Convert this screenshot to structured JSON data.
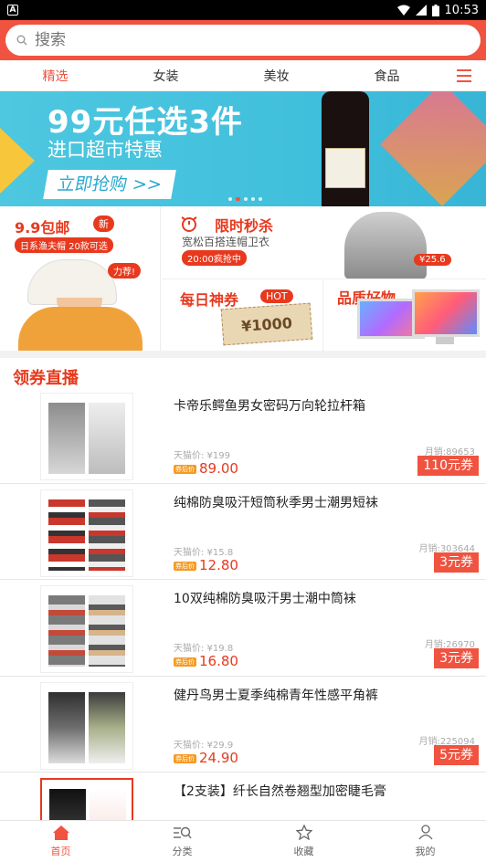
{
  "status_bar": {
    "time": "10:53",
    "app_icon": "A"
  },
  "search": {
    "placeholder": "搜索"
  },
  "categories": [
    {
      "label": "精选",
      "active": true
    },
    {
      "label": "女装"
    },
    {
      "label": "美妆"
    },
    {
      "label": "食品"
    }
  ],
  "banner": {
    "headline": "99元任选3件",
    "subtitle": "进口超市特惠",
    "cta": "立即抢购 >>",
    "dots_total": 5,
    "dot_active": 2
  },
  "promo": {
    "p1": {
      "title": "9.9包邮",
      "badge": "新",
      "strip": "日系渔夫帽 20款可选",
      "tag": "力荐!"
    },
    "p2": {
      "title": "限时秒杀",
      "subtitle": "宽松百搭连帽卫衣",
      "time_strip": "20:00疯抢中",
      "price_tag": "¥25.6"
    },
    "p3": {
      "title": "每日神券",
      "badge": "HOT",
      "coupon": "¥1000"
    },
    "p4": {
      "title": "品质好物"
    }
  },
  "section": {
    "title": "领券直播"
  },
  "products": [
    {
      "title": "卡帝乐鳄鱼男女密码万向轮拉杆箱",
      "orig": "天猫价: ¥199",
      "price": "89.00",
      "sales": "月销:89653",
      "coupon": "110元券",
      "price_tag": "券后价"
    },
    {
      "title": "纯棉防臭吸汗短筒秋季男士潮男短袜",
      "orig": "天猫价: ¥15.8",
      "price": "12.80",
      "sales": "月销:303644",
      "coupon": "3元券",
      "price_tag": "券后价"
    },
    {
      "title": "10双纯棉防臭吸汗男士潮中筒袜",
      "orig": "天猫价: ¥19.8",
      "price": "16.80",
      "sales": "月销:26970",
      "coupon": "3元券",
      "price_tag": "券后价"
    },
    {
      "title": "健丹鸟男士夏季纯棉青年性感平角裤",
      "orig": "天猫价: ¥29.9",
      "price": "24.90",
      "sales": "月销:225094",
      "coupon": "5元券",
      "price_tag": "券后价"
    },
    {
      "title": "【2支装】纤长自然卷翘型加密睫毛膏",
      "orig": "",
      "price": "",
      "sales": "",
      "coupon": "",
      "price_tag": ""
    }
  ],
  "tabbar": [
    {
      "label": "首页",
      "icon": "home-icon",
      "active": true
    },
    {
      "label": "分类",
      "icon": "category-search-icon"
    },
    {
      "label": "收藏",
      "icon": "star-icon"
    },
    {
      "label": "我的",
      "icon": "user-icon"
    }
  ],
  "colors": {
    "accent": "#f0533f",
    "price": "#e8391e",
    "banner_bg": "#41c0dc"
  }
}
